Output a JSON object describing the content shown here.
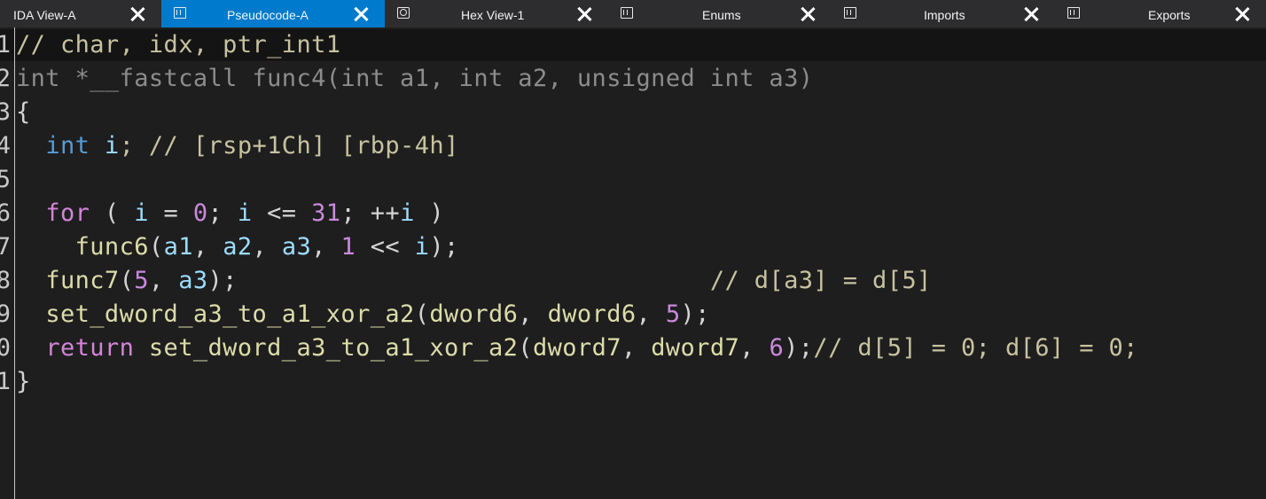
{
  "tabs": [
    {
      "label": "IDA View-A",
      "icon": "none",
      "active": false
    },
    {
      "label": "Pseudocode-A",
      "icon": "pseudocode-icon",
      "active": true
    },
    {
      "label": "Hex View-1",
      "icon": "hex-view-icon",
      "active": false
    },
    {
      "label": "Enums",
      "icon": "enums-icon",
      "active": false
    },
    {
      "label": "Imports",
      "icon": "imports-icon",
      "active": false
    },
    {
      "label": "Exports",
      "icon": "exports-icon",
      "active": false
    }
  ],
  "editor": {
    "line_numbers": [
      "1",
      "2",
      "3",
      "4",
      "5",
      "6",
      "7",
      "8",
      "9",
      "0",
      "1"
    ],
    "lines": [
      [
        {
          "t": "// char, idx, ptr_int1",
          "c": "comment"
        }
      ],
      [
        {
          "t": "int *__fastcall func4(int a1, int a2, unsigned int a3)",
          "c": "faded"
        }
      ],
      [
        {
          "t": "{",
          "c": "punct"
        }
      ],
      [
        {
          "t": "  ",
          "c": "punct"
        },
        {
          "t": "int",
          "c": "type"
        },
        {
          "t": " ",
          "c": "punct"
        },
        {
          "t": "i",
          "c": "ident"
        },
        {
          "t": "; // [rsp+1Ch] [rbp-4h]",
          "c": "comment"
        }
      ],
      [],
      [
        {
          "t": "  ",
          "c": "punct"
        },
        {
          "t": "for",
          "c": "kw"
        },
        {
          "t": " ( ",
          "c": "punct"
        },
        {
          "t": "i",
          "c": "ident"
        },
        {
          "t": " = ",
          "c": "punct"
        },
        {
          "t": "0",
          "c": "num"
        },
        {
          "t": "; ",
          "c": "punct"
        },
        {
          "t": "i",
          "c": "ident"
        },
        {
          "t": " <= ",
          "c": "punct"
        },
        {
          "t": "31",
          "c": "num"
        },
        {
          "t": "; ++",
          "c": "punct"
        },
        {
          "t": "i",
          "c": "ident"
        },
        {
          "t": " )",
          "c": "punct"
        }
      ],
      [
        {
          "t": "    ",
          "c": "punct"
        },
        {
          "t": "func6",
          "c": "func"
        },
        {
          "t": "(",
          "c": "punct"
        },
        {
          "t": "a1",
          "c": "ident"
        },
        {
          "t": ", ",
          "c": "punct"
        },
        {
          "t": "a2",
          "c": "ident"
        },
        {
          "t": ", ",
          "c": "punct"
        },
        {
          "t": "a3",
          "c": "ident"
        },
        {
          "t": ", ",
          "c": "punct"
        },
        {
          "t": "1",
          "c": "num"
        },
        {
          "t": " << ",
          "c": "punct"
        },
        {
          "t": "i",
          "c": "ident"
        },
        {
          "t": ");",
          "c": "punct"
        }
      ],
      [
        {
          "t": "  ",
          "c": "punct"
        },
        {
          "t": "func7",
          "c": "func"
        },
        {
          "t": "(",
          "c": "punct"
        },
        {
          "t": "5",
          "c": "num"
        },
        {
          "t": ", ",
          "c": "punct"
        },
        {
          "t": "a3",
          "c": "ident"
        },
        {
          "t": ");",
          "c": "punct"
        },
        {
          "t": "                                // d[a3] = d[5]",
          "c": "comment"
        }
      ],
      [
        {
          "t": "  ",
          "c": "punct"
        },
        {
          "t": "set_dword_a3_to_a1_xor_a2",
          "c": "func"
        },
        {
          "t": "(",
          "c": "punct"
        },
        {
          "t": "dword6",
          "c": "func"
        },
        {
          "t": ", ",
          "c": "punct"
        },
        {
          "t": "dword6",
          "c": "func"
        },
        {
          "t": ", ",
          "c": "punct"
        },
        {
          "t": "5",
          "c": "num"
        },
        {
          "t": ");",
          "c": "punct"
        }
      ],
      [
        {
          "t": "  ",
          "c": "punct"
        },
        {
          "t": "return",
          "c": "kw"
        },
        {
          "t": " ",
          "c": "punct"
        },
        {
          "t": "set_dword_a3_to_a1_xor_a2",
          "c": "func"
        },
        {
          "t": "(",
          "c": "punct"
        },
        {
          "t": "dword7",
          "c": "func"
        },
        {
          "t": ", ",
          "c": "punct"
        },
        {
          "t": "dword7",
          "c": "func"
        },
        {
          "t": ", ",
          "c": "punct"
        },
        {
          "t": "6",
          "c": "num"
        },
        {
          "t": ");",
          "c": "punct"
        },
        {
          "t": "// d[5] = 0; d[6] = 0;",
          "c": "comment"
        }
      ],
      [
        {
          "t": "}",
          "c": "punct"
        }
      ]
    ]
  },
  "colors": {
    "tab_bar": "#2d2d30",
    "active_tab": "#007acc",
    "editor_bg": "#1e1e1e",
    "highlight_row": "#141414"
  }
}
